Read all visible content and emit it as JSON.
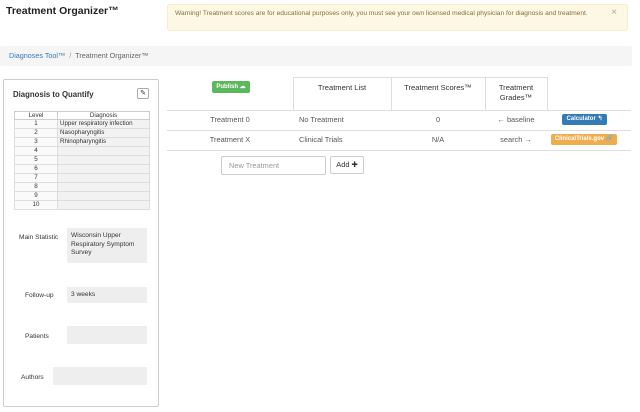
{
  "app": {
    "title": "Treatment Organizer™"
  },
  "warning": {
    "text": "Warning! Treatment scores are for educational purposes only, you must see your own licensed medical physician for diagnosis and treatment.",
    "close": "×"
  },
  "breadcrumb": {
    "parent": "Diagnoses Tool™",
    "separator": "/",
    "current": "Treatment Organizer™"
  },
  "diagnosis_panel": {
    "title": "Diagnosis to Quantify",
    "edit_icon": "✎",
    "table": {
      "headers": [
        "Level",
        "Diagnosis"
      ],
      "rows": [
        {
          "level": "1",
          "diagnosis": "Upper respiratory infection"
        },
        {
          "level": "2",
          "diagnosis": "Nasopharyngitis"
        },
        {
          "level": "3",
          "diagnosis": "Rhinopharyngitis"
        },
        {
          "level": "4",
          "diagnosis": ""
        },
        {
          "level": "5",
          "diagnosis": ""
        },
        {
          "level": "6",
          "diagnosis": ""
        },
        {
          "level": "7",
          "diagnosis": ""
        },
        {
          "level": "8",
          "diagnosis": ""
        },
        {
          "level": "9",
          "diagnosis": ""
        },
        {
          "level": "10",
          "diagnosis": ""
        }
      ]
    },
    "main_statistic": {
      "label": "Main Statistic",
      "value": "Wisconsin Upper Respiratory Symptom Survey"
    },
    "follow_up": {
      "label": "Follow-up",
      "value": "3 weeks"
    },
    "patients": {
      "label": "Patients",
      "value": ""
    },
    "authors": {
      "label": "Authors",
      "value": ""
    }
  },
  "treatment_table": {
    "publish_label": "Publish ☁",
    "headers": {
      "list": "Treatment List",
      "scores": "Treatment Scores™",
      "grades_1": "Treatment",
      "grades_2": "Grades™"
    },
    "rows": [
      {
        "name": "Treatment 0",
        "list": "No Treatment",
        "score": "0",
        "grade": "← baseline",
        "action": "Calculator ↰",
        "action_color": "#337ab7"
      },
      {
        "name": "Treatment X",
        "list": "Clinical Trials",
        "score": "N/A",
        "grade": "search →",
        "action": "ClinicalTrials.gov 🔗",
        "action_color": "#f0ad4e"
      }
    ],
    "new_treatment": {
      "placeholder": "New Treatment",
      "value": ""
    },
    "add_label": "Add ✚"
  },
  "colors": {
    "accent": "#337ab7",
    "publish": "#5cb85c",
    "warning_bg": "#fcf8e3",
    "warning_text": "#8a6d3b",
    "clinicaltrials": "#f0ad4e"
  }
}
